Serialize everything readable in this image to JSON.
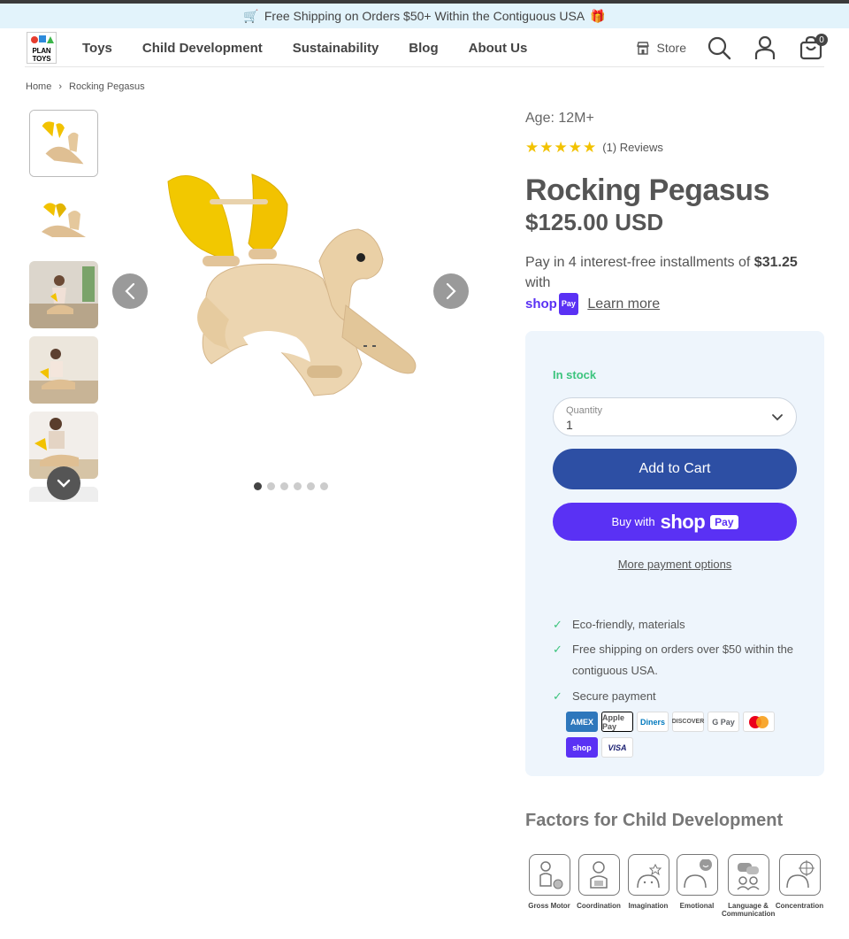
{
  "promo": {
    "text": "Free Shipping on Orders $50+ Within the Contiguous USA",
    "left_icon": "cart-icon",
    "right_icon": "gift-icon"
  },
  "logo": {
    "text_line1": "PLAN",
    "text_line2": "TOYS"
  },
  "nav": {
    "items": [
      "Toys",
      "Child Development",
      "Sustainability",
      "Blog",
      "About Us"
    ]
  },
  "header": {
    "store_label": "Store",
    "cart_count": "0"
  },
  "breadcrumb": {
    "home": "Home",
    "current": "Rocking Pegasus"
  },
  "gallery": {
    "thumb_count": 6,
    "dots_count": 6,
    "active_dot": 0
  },
  "product": {
    "age": "Age: 12M+",
    "rating": 5,
    "reviews": "(1) Reviews",
    "title": "Rocking Pegasus",
    "price": "$125.00 USD",
    "installment_pre": "Pay in 4 interest-free installments of",
    "installment_amount": "$31.25",
    "installment_post": "with",
    "shop_word": "shop",
    "pay_word": "Pay",
    "learn_more": "Learn more"
  },
  "buybox": {
    "stock": "In stock",
    "quantity_label": "Quantity",
    "quantity_value": "1",
    "add_to_cart": "Add to Cart",
    "buy_with": "Buy with",
    "shop_word": "shop",
    "pay_word": "Pay",
    "more_options": "More payment options",
    "features": [
      "Eco-friendly, materials",
      "Free shipping on orders over $50 within the",
      "contiguous USA.",
      "Secure payment"
    ],
    "payments": [
      "AMEX",
      "Apple Pay",
      "Diners",
      "DISCOVER",
      "G Pay",
      "Mastercard",
      "shop",
      "VISA"
    ]
  },
  "factors": {
    "title": "Factors for Child Development",
    "items": [
      "Gross Motor",
      "Coordination",
      "Imagination",
      "Emotional",
      "Language &",
      "Concentration"
    ],
    "language_line2": "Communication"
  },
  "colors": {
    "primary": "#2d4fa4",
    "shop_purple": "#5a31f4",
    "stock_green": "#3dc47e",
    "promo_bg": "#e2f3fb",
    "box_bg": "#eef5fc",
    "star": "#f2c200"
  }
}
